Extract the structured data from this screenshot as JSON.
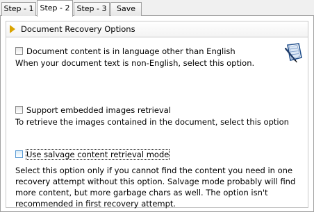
{
  "tabs": [
    {
      "label": "Step - 1",
      "active": false
    },
    {
      "label": "Step - 2",
      "active": true
    },
    {
      "label": "Step - 3",
      "active": false
    },
    {
      "label": "Save",
      "active": false
    }
  ],
  "group": {
    "title": "Document Recovery Options",
    "icon": "document-pen-icon"
  },
  "options": [
    {
      "label": "Document content is in language other than English",
      "checked": false,
      "description": "When your document text is non-English, select this option."
    },
    {
      "label": "Support embedded images retrieval",
      "checked": false,
      "description": "To retrieve the images contained in the document, select this option"
    },
    {
      "label": "Use salvage content retrieval mode",
      "checked": false,
      "focused": true,
      "description": "Select this option only if you cannot find the content you need in one recovery attempt without this option. Salvage mode probably will find more content, but more garbage chars as well. The option isn't recommended in first recovery attempt."
    }
  ],
  "colors": {
    "accent_arrow": "#d9a300",
    "focus_border": "#5b9bd5",
    "border": "#a0a0a0"
  }
}
